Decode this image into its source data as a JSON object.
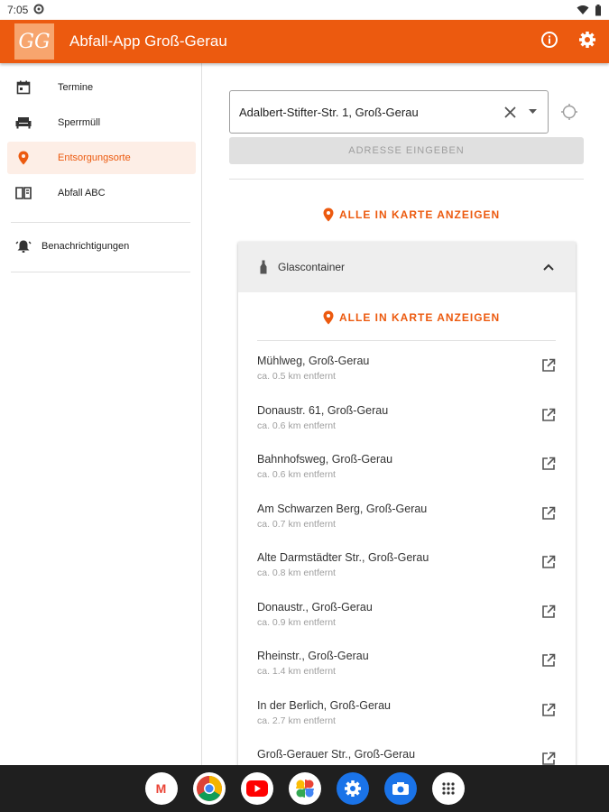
{
  "status_bar": {
    "time": "7:05"
  },
  "app_bar": {
    "logo_text": "GG",
    "title": "Abfall-App Groß-Gerau"
  },
  "sidebar": {
    "items": [
      {
        "label": "Termine"
      },
      {
        "label": "Sperrmüll"
      },
      {
        "label": "Entsorgungsorte"
      },
      {
        "label": "Abfall ABC"
      }
    ],
    "notifications_label": "Benachrichtigungen"
  },
  "main": {
    "address_value": "Adalbert-Stifter-Str. 1, Groß-Gerau",
    "address_button": "ADRESSE EINGEBEN",
    "show_all_label": "ALLE IN KARTE ANZEIGEN",
    "section": {
      "title": "Glascontainer",
      "show_all_label": "ALLE IN KARTE ANZEIGEN",
      "locations": [
        {
          "name": "Mühlweg, Groß-Gerau",
          "distance": "ca. 0.5 km entfernt"
        },
        {
          "name": "Donaustr. 61, Groß-Gerau",
          "distance": "ca. 0.6 km entfernt"
        },
        {
          "name": "Bahnhofsweg, Groß-Gerau",
          "distance": "ca. 0.6 km entfernt"
        },
        {
          "name": "Am Schwarzen Berg, Groß-Gerau",
          "distance": "ca. 0.7 km entfernt"
        },
        {
          "name": "Alte Darmstädter Str., Groß-Gerau",
          "distance": "ca. 0.8 km entfernt"
        },
        {
          "name": "Donaustr., Groß-Gerau",
          "distance": "ca. 0.9 km entfernt"
        },
        {
          "name": "Rheinstr., Groß-Gerau",
          "distance": "ca. 1.4 km entfernt"
        },
        {
          "name": "In der Berlich, Groß-Gerau",
          "distance": "ca. 2.7 km entfernt"
        },
        {
          "name": "Groß-Gerauer Str., Groß-Gerau",
          "distance": ""
        }
      ]
    }
  },
  "dock": [
    {
      "icon": "gmail-icon",
      "glyph": "M",
      "color": "#ea4335"
    },
    {
      "icon": "chrome-icon",
      "glyph": "",
      "color": "#34a853"
    },
    {
      "icon": "youtube-icon",
      "glyph": "",
      "color": "#ff0000"
    },
    {
      "icon": "photos-icon",
      "glyph": "",
      "color": "#fbbc05"
    },
    {
      "icon": "settings-icon",
      "glyph": "",
      "color": "#1a73e8"
    },
    {
      "icon": "camera-icon",
      "glyph": "",
      "color": "#1a73e8"
    },
    {
      "icon": "apps-icon",
      "glyph": "",
      "color": "#333333"
    }
  ],
  "colors": {
    "accent": "#ec5a0f",
    "active_bg": "#fdeee6"
  }
}
